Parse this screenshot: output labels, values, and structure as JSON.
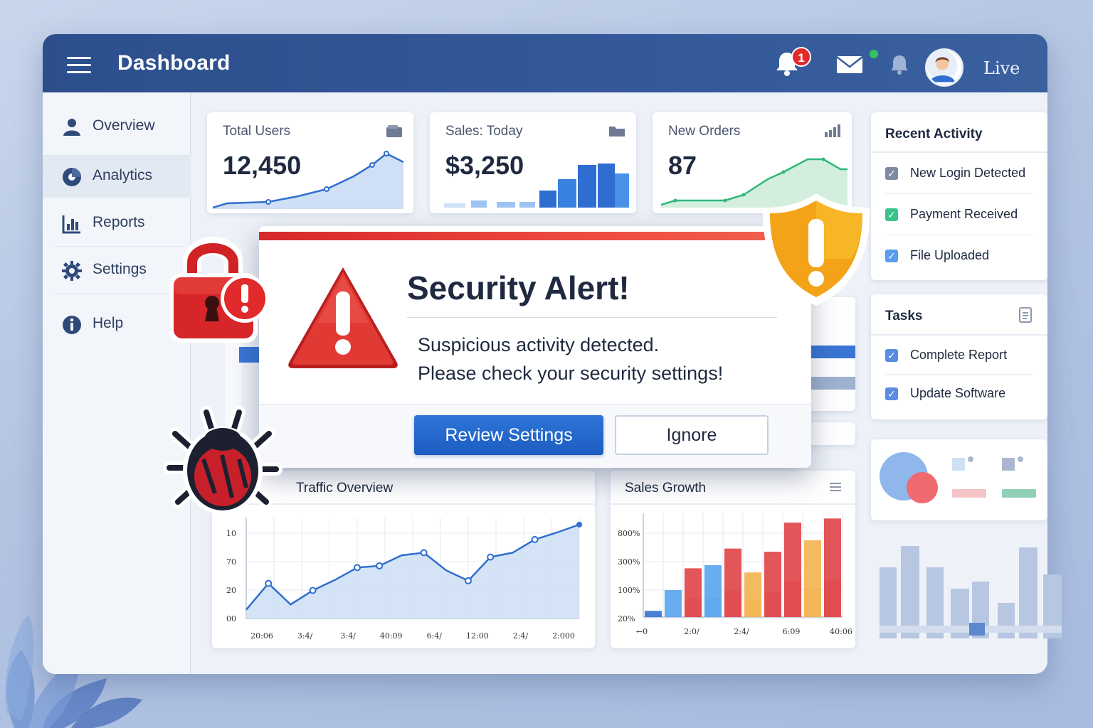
{
  "header": {
    "title": "Dashboard",
    "notification_count": "1",
    "status_label": "Live"
  },
  "sidebar": {
    "items": [
      {
        "label": "Overview",
        "icon": "user-icon"
      },
      {
        "label": "Analytics",
        "icon": "analytics-icon"
      },
      {
        "label": "Reports",
        "icon": "reports-icon"
      },
      {
        "label": "Settings",
        "icon": "gear-icon"
      },
      {
        "label": "Help",
        "icon": "help-icon"
      }
    ],
    "active_index": 1
  },
  "stats": [
    {
      "label": "Total Users",
      "value": "12,450",
      "color": "#2f6ed0"
    },
    {
      "label": "Sales: Today",
      "value": "$3,250",
      "color": "#2f6ed0"
    },
    {
      "label": "New Orders",
      "value": "87",
      "color": "#2fb77a"
    }
  ],
  "recent_activity": {
    "title": "Recent Activity",
    "items": [
      {
        "label": "New Login Detected",
        "color": "#7d8aa3"
      },
      {
        "label": "Payment Received",
        "color": "#39c28a"
      },
      {
        "label": "File Uploaded",
        "color": "#5a9cf0"
      }
    ]
  },
  "tasks": {
    "title": "Tasks",
    "items": [
      {
        "label": "Complete Report"
      },
      {
        "label": "Update Software"
      }
    ]
  },
  "alert": {
    "title": "Security Alert!",
    "line1": "Suspicious activity detected.",
    "line2": "Please check your security settings!",
    "primary_button": "Review Settings",
    "secondary_button": "Ignore",
    "accent": "#e02f2f"
  },
  "traffic": {
    "title": "Traffic Overview"
  },
  "sales_growth": {
    "title": "Sales Growth"
  },
  "chart_data": [
    {
      "type": "line",
      "title": "Traffic Overview",
      "y_ticks": [
        "10",
        "70",
        "20",
        "00"
      ],
      "x_ticks": [
        "20:06",
        "3:4/",
        "3:4/",
        "40:09",
        "6:4/",
        "12:00",
        "2:4/",
        "2:000"
      ],
      "values": [
        10,
        40,
        16,
        32,
        44,
        58,
        60,
        72,
        75,
        55,
        43,
        70,
        75,
        90,
        98,
        107
      ],
      "ylim": [
        0,
        115
      ],
      "grid": true
    },
    {
      "type": "bar",
      "title": "Sales Growth",
      "y_ticks": [
        "800%",
        "300%",
        "100%",
        "20%"
      ],
      "x_ticks": [
        "←0",
        "2:0/",
        "2:4/",
        "6:09",
        "40:06"
      ],
      "series_colors": [
        "#3a75d4",
        "#5aa6ef",
        "#e0474a",
        "#f3b452"
      ],
      "values": [
        6,
        26,
        47,
        50,
        66,
        43,
        63,
        91,
        74,
        95
      ],
      "bar_colors": [
        "#3a75d4",
        "#5aa6ef",
        "#e0474a",
        "#5aa6ef",
        "#e0474a",
        "#f3b452",
        "#e0474a",
        "#e0474a",
        "#f3b452",
        "#e0474a"
      ],
      "ylim": [
        0,
        100
      ],
      "grid": true
    }
  ]
}
